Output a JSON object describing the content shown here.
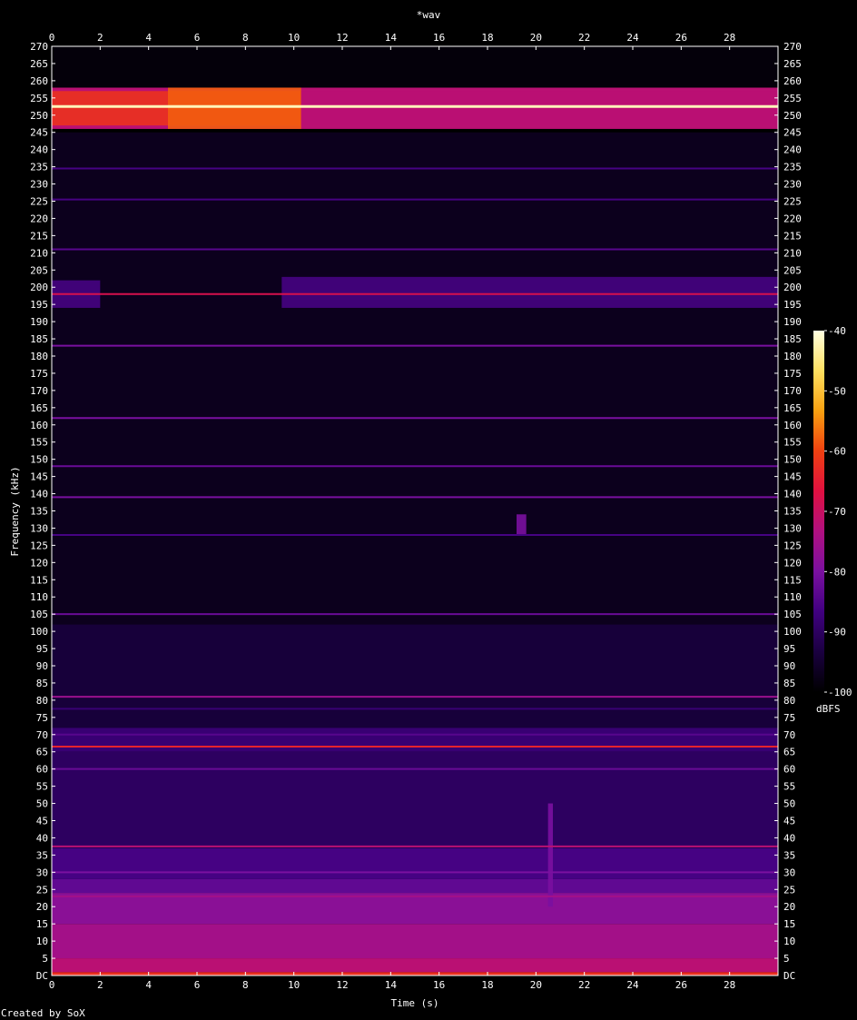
{
  "chart_data": {
    "type": "heatmap",
    "title": "*wav",
    "xlabel": "Time (s)",
    "ylabel": "Frequency (kHz)",
    "xlim": [
      0,
      30
    ],
    "ylim": [
      0,
      270
    ],
    "x_ticks": [
      0,
      2,
      4,
      6,
      8,
      10,
      12,
      14,
      16,
      18,
      20,
      22,
      24,
      26,
      28
    ],
    "y_ticks": [
      "DC",
      "5",
      "10",
      "15",
      "20",
      "25",
      "30",
      "35",
      "40",
      "45",
      "50",
      "55",
      "60",
      "65",
      "70",
      "75",
      "80",
      "85",
      "90",
      "95",
      "100",
      "105",
      "110",
      "115",
      "120",
      "125",
      "130",
      "135",
      "140",
      "145",
      "150",
      "155",
      "160",
      "165",
      "170",
      "175",
      "180",
      "185",
      "190",
      "195",
      "200",
      "205",
      "210",
      "215",
      "220",
      "225",
      "230",
      "235",
      "240",
      "245",
      "250",
      "255",
      "260",
      "265",
      "270"
    ],
    "colorbar": {
      "label": "dBFS",
      "range": [
        -100,
        -40
      ],
      "ticks": [
        "-40",
        "-50",
        "-60",
        "-70",
        "-80",
        "-90",
        "-100"
      ],
      "colors": [
        "#000000",
        "#1a0040",
        "#400080",
        "#7a10a0",
        "#b01080",
        "#e01040",
        "#f04010",
        "#f8a010",
        "#ffe060",
        "#ffffe0"
      ]
    },
    "bands": [
      {
        "f_min": 0,
        "f_max": 1,
        "level_dbfs": -63
      },
      {
        "f_min": 1,
        "f_max": 5,
        "level_dbfs": -72
      },
      {
        "f_min": 5,
        "f_max": 15,
        "level_dbfs": -75
      },
      {
        "f_min": 15,
        "f_max": 24,
        "level_dbfs": -78
      },
      {
        "f_min": 24,
        "f_max": 28,
        "level_dbfs": -83
      },
      {
        "f_min": 28,
        "f_max": 37,
        "level_dbfs": -86
      },
      {
        "f_min": 37,
        "f_max": 65,
        "level_dbfs": -90
      },
      {
        "f_min": 65,
        "f_max": 72,
        "level_dbfs": -88
      },
      {
        "f_min": 72,
        "f_max": 102,
        "level_dbfs": -94
      },
      {
        "f_min": 102,
        "f_max": 245,
        "level_dbfs": -97
      },
      {
        "f_min": 246,
        "f_max": 258,
        "level_dbfs": -72
      },
      {
        "f_min": 258,
        "f_max": 270,
        "level_dbfs": -99
      }
    ],
    "lines": [
      {
        "freq_khz": 0.5,
        "level_dbfs": -62
      },
      {
        "freq_khz": 23,
        "level_dbfs": -75
      },
      {
        "freq_khz": 30,
        "level_dbfs": -80
      },
      {
        "freq_khz": 37.5,
        "level_dbfs": -72
      },
      {
        "freq_khz": 60,
        "level_dbfs": -82
      },
      {
        "freq_khz": 66.5,
        "level_dbfs": -64
      },
      {
        "freq_khz": 70,
        "level_dbfs": -84
      },
      {
        "freq_khz": 77.5,
        "level_dbfs": -88
      },
      {
        "freq_khz": 81,
        "level_dbfs": -76
      },
      {
        "freq_khz": 105,
        "level_dbfs": -82
      },
      {
        "freq_khz": 128,
        "level_dbfs": -86
      },
      {
        "freq_khz": 139,
        "level_dbfs": -80
      },
      {
        "freq_khz": 148,
        "level_dbfs": -82
      },
      {
        "freq_khz": 162,
        "level_dbfs": -80
      },
      {
        "freq_khz": 183,
        "level_dbfs": -80
      },
      {
        "freq_khz": 198,
        "level_dbfs": -68
      },
      {
        "freq_khz": 211,
        "level_dbfs": -84
      },
      {
        "freq_khz": 225.5,
        "level_dbfs": -86
      },
      {
        "freq_khz": 234.5,
        "level_dbfs": -86
      },
      {
        "freq_khz": 252.5,
        "level_dbfs": -42
      }
    ],
    "bursts": [
      {
        "t_min": 0,
        "t_max": 10.3,
        "f_min": 247,
        "f_max": 257,
        "level_dbfs": -62
      },
      {
        "t_min": 4.8,
        "t_max": 10.3,
        "f_min": 246,
        "f_max": 258,
        "level_dbfs": -58
      },
      {
        "t_min": 10.3,
        "t_max": 30,
        "f_min": 247,
        "f_max": 257,
        "level_dbfs": -72
      },
      {
        "t_min": 0,
        "t_max": 2.0,
        "f_min": 194,
        "f_max": 202,
        "level_dbfs": -86
      },
      {
        "t_min": 9.5,
        "t_max": 30,
        "f_min": 194,
        "f_max": 203,
        "level_dbfs": -86
      },
      {
        "t_min": 19.2,
        "t_max": 19.6,
        "f_min": 128,
        "f_max": 134,
        "level_dbfs": -80
      },
      {
        "t_min": 20.5,
        "t_max": 20.7,
        "f_min": 20,
        "f_max": 50,
        "level_dbfs": -80
      }
    ],
    "credit": "Created by SoX"
  }
}
